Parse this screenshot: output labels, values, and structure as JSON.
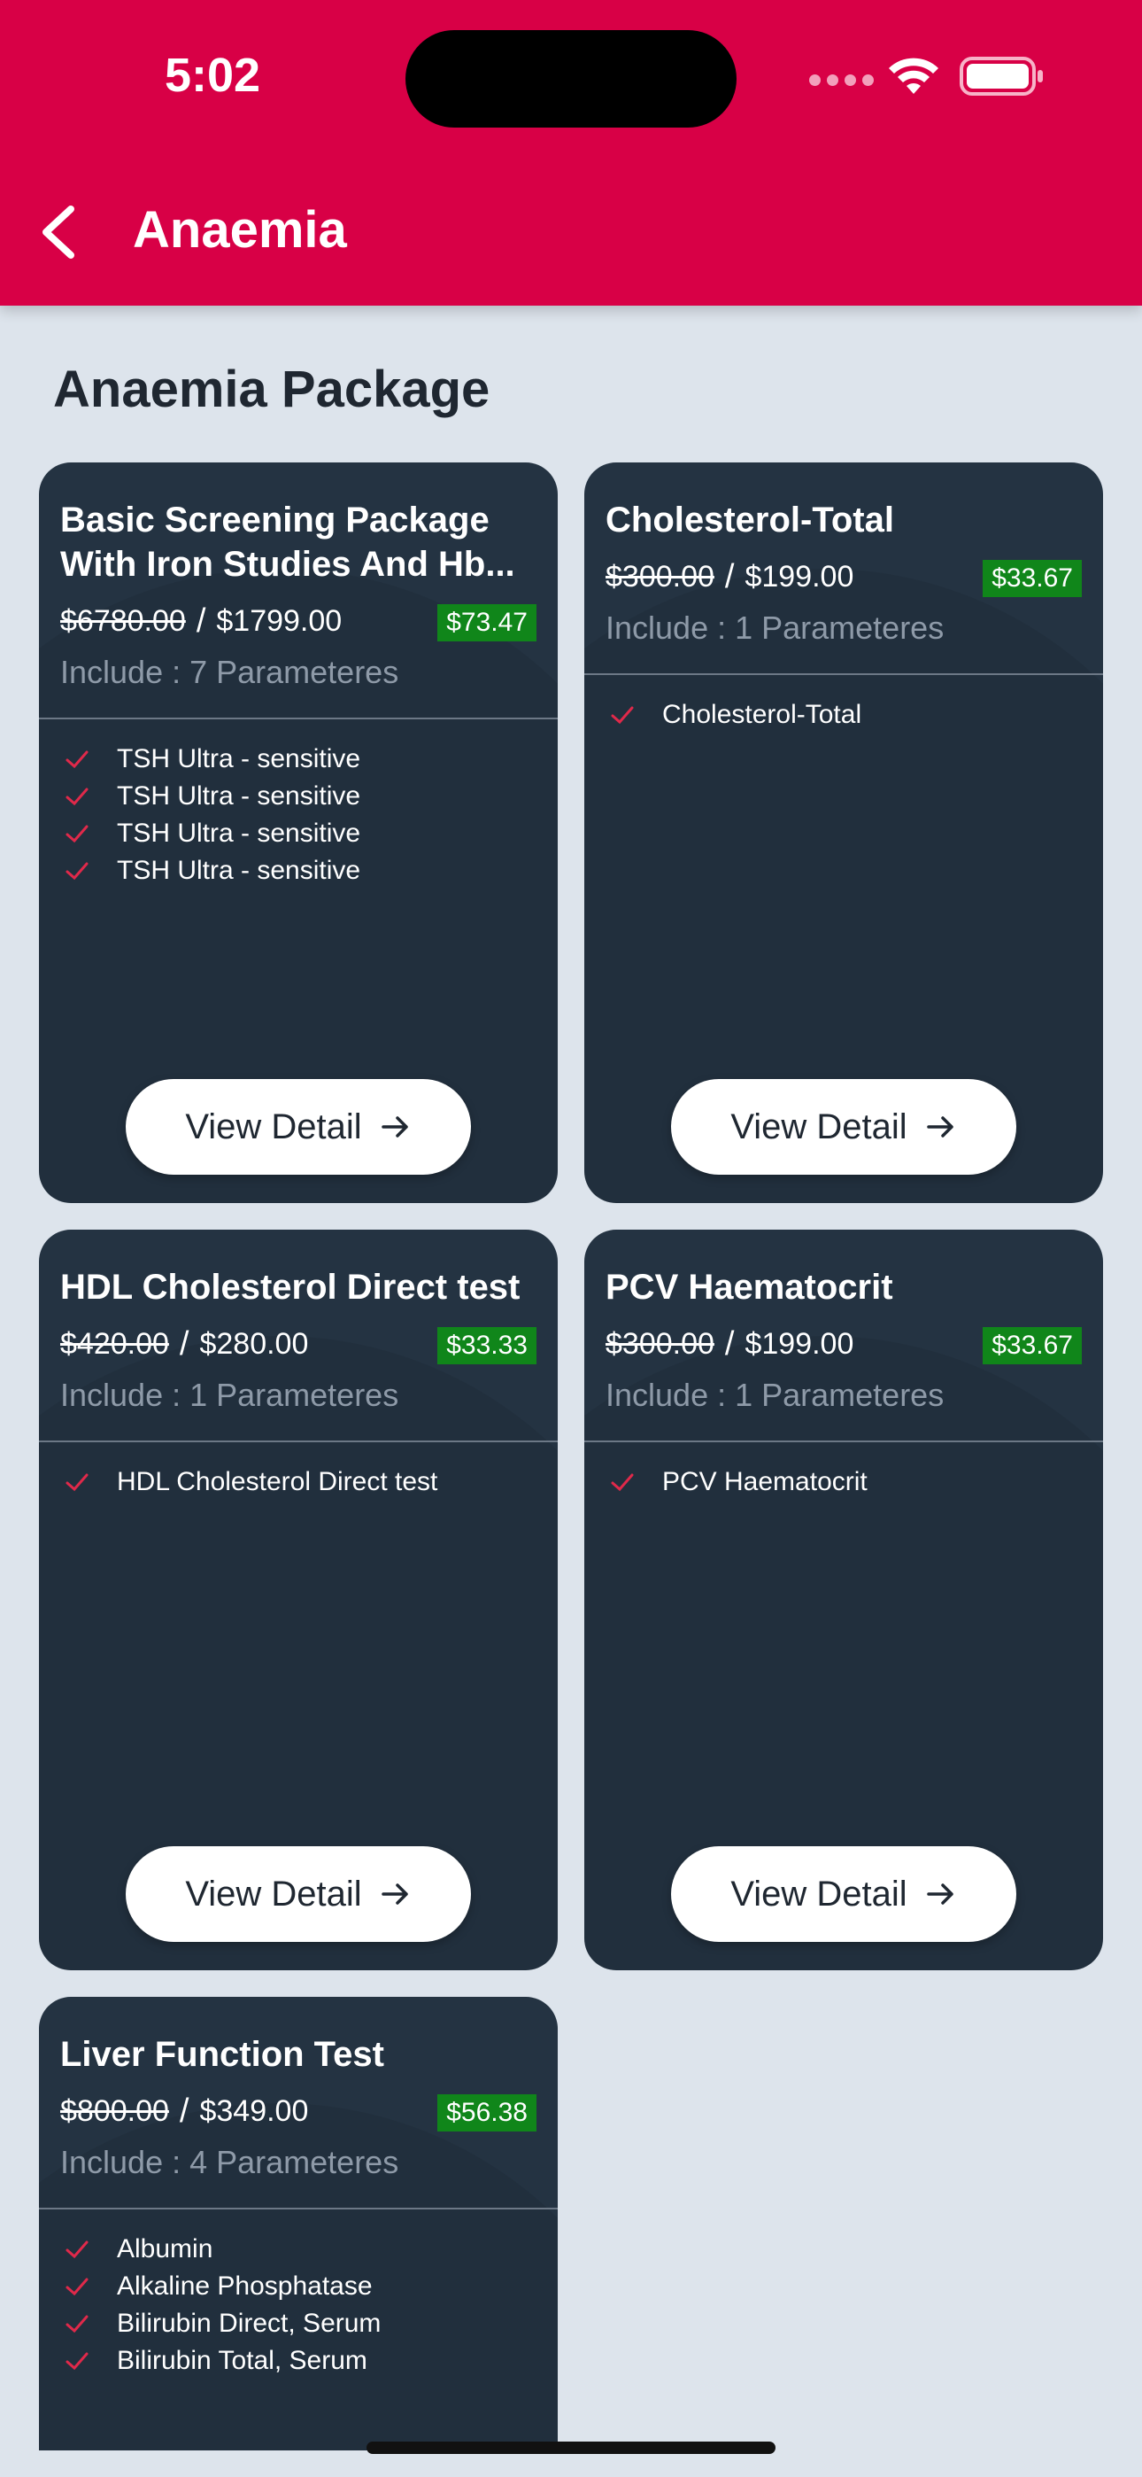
{
  "status": {
    "time": "5:02"
  },
  "nav": {
    "title": "Anaemia"
  },
  "section": {
    "title": "Anaemia Package"
  },
  "cards": [
    {
      "title": "Basic Screening Package With Iron Studies And Hb...",
      "old_price": "$6780.00",
      "sep": "/",
      "price": "$1799.00",
      "discount": "$73.47",
      "include": "Include : 7 Parameteres",
      "items": [
        "TSH Ultra - sensitive",
        "TSH Ultra - sensitive",
        "TSH Ultra - sensitive",
        "TSH Ultra - sensitive"
      ],
      "button": "View Detail"
    },
    {
      "title": "Cholesterol-Total",
      "old_price": "$300.00",
      "sep": "/",
      "price": "$199.00",
      "discount": "$33.67",
      "include": "Include : 1 Parameteres",
      "items": [
        "Cholesterol-Total"
      ],
      "button": "View Detail"
    },
    {
      "title": "HDL Cholesterol Direct test",
      "old_price": "$420.00",
      "sep": "/",
      "price": "$280.00",
      "discount": "$33.33",
      "include": "Include : 1 Parameteres",
      "items": [
        "HDL Cholesterol Direct test"
      ],
      "button": "View Detail"
    },
    {
      "title": "PCV Haematocrit",
      "old_price": "$300.00",
      "sep": "/",
      "price": "$199.00",
      "discount": "$33.67",
      "include": "Include : 1 Parameteres",
      "items": [
        "PCV Haematocrit"
      ],
      "button": "View Detail"
    },
    {
      "title": "Liver Function Test",
      "old_price": "$800.00",
      "sep": "/",
      "price": "$349.00",
      "discount": "$56.38",
      "include": "Include : 4 Parameteres",
      "items": [
        "Albumin",
        "Alkaline Phosphatase",
        "Bilirubin Direct, Serum",
        "Bilirubin Total, Serum"
      ]
    }
  ],
  "colors": {
    "brand": "#d80046",
    "card": "#243342",
    "discount": "#10861a",
    "check": "#e0294a"
  }
}
